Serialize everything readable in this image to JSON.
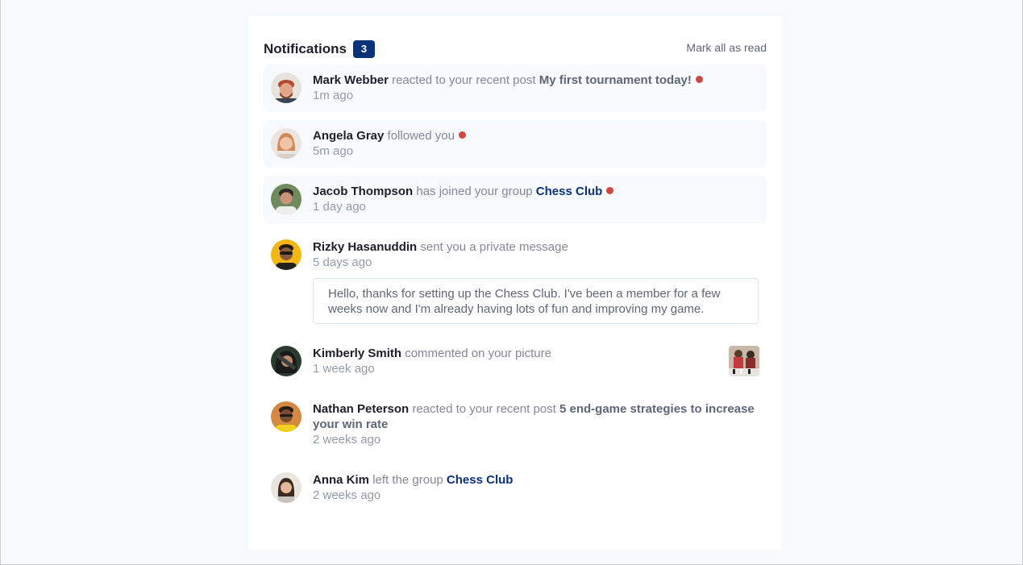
{
  "header": {
    "title": "Notifications",
    "count": "3",
    "mark_all": "Mark all as read"
  },
  "notifications": [
    {
      "name": "Mark Webber",
      "action": "reacted to your recent post",
      "target": "My first tournament today!",
      "target_type": "post",
      "time": "1m ago",
      "unread": true
    },
    {
      "name": "Angela Gray",
      "action": "followed you",
      "time": "5m ago",
      "unread": true
    },
    {
      "name": "Jacob Thompson",
      "action": "has joined your group",
      "target": "Chess Club",
      "target_type": "group",
      "time": "1 day ago",
      "unread": true
    },
    {
      "name": "Rizky Hasanuddin",
      "action": "sent you a private message",
      "time": "5 days ago",
      "unread": false,
      "message": "Hello, thanks for setting up the Chess Club. I've been a member for a few weeks now and I'm already having lots of fun and improving my game."
    },
    {
      "name": "Kimberly Smith",
      "action": "commented on your picture",
      "time": "1 week ago",
      "unread": false
    },
    {
      "name": "Nathan Peterson",
      "action": "reacted to your recent post",
      "target": "5 end-game strategies to increase your win rate",
      "target_type": "post",
      "time": "2 weeks ago",
      "unread": false
    },
    {
      "name": "Anna Kim",
      "action": "left the group",
      "target": "Chess Club",
      "target_type": "group",
      "time": "2 weeks ago",
      "unread": false
    }
  ],
  "colors": {
    "accent": "#0a327b",
    "unread_dot": "#d24642",
    "unread_bg": "#f7fafd",
    "page_bg": "#f7fafd"
  }
}
